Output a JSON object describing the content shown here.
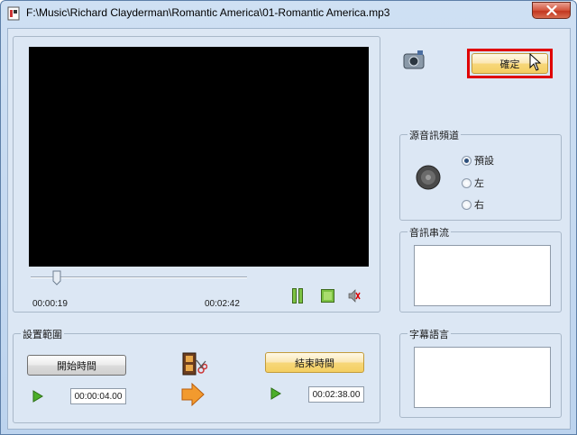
{
  "window": {
    "title": "F:\\Music\\Richard Clayderman\\Romantic America\\01-Romantic America.mp3",
    "close_icon": "close-icon"
  },
  "player": {
    "current_time": "00:00:19",
    "total_time": "00:02:42",
    "seek_position": 0.12,
    "icons": [
      "pause-icon",
      "stop-icon",
      "mute-icon"
    ]
  },
  "range": {
    "group_label": "設置範圍",
    "start_button": "開始時間",
    "end_button": "結束時間",
    "start_value": "00:00:04.00",
    "end_value": "00:02:38.00"
  },
  "actions": {
    "ok_button": "確定"
  },
  "audio_channel": {
    "group_label": "源音訊頻道",
    "options": [
      "預設",
      "左",
      "右"
    ],
    "selected": "預設"
  },
  "audio_stream": {
    "group_label": "音訊串流"
  },
  "subtitle": {
    "group_label": "字幕語言"
  },
  "colors": {
    "highlight": "#e00000",
    "video_bg": "#000000"
  }
}
